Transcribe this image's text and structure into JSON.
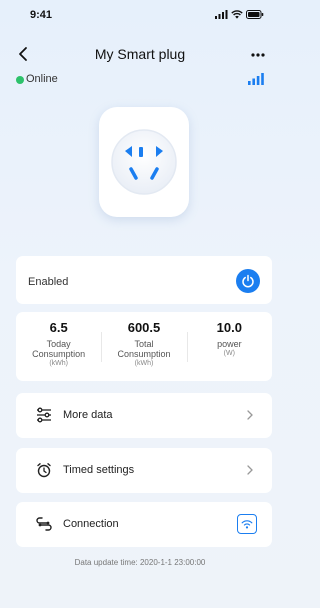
{
  "status_bar": {
    "time": "9:41"
  },
  "header": {
    "title": "My Smart plug"
  },
  "device": {
    "status": "Online",
    "status_color": "#2dc26b",
    "signal_color": "#1b7ef0"
  },
  "switch": {
    "label": "Enabled",
    "state": "on",
    "button_color": "#1b7ef0"
  },
  "stats": [
    {
      "value": "6.5",
      "label1": "Today",
      "label2": "Consumption",
      "unit": "(kWh)"
    },
    {
      "value": "600.5",
      "label1": "Total",
      "label2": "Consumption",
      "unit": "(kWh)"
    },
    {
      "value": "10.0",
      "label1": "power",
      "label2": "",
      "unit": "(W)"
    }
  ],
  "menu": {
    "more_data": {
      "label": "More data",
      "icon": "sliders-icon"
    },
    "timed_settings": {
      "label": "Timed settings",
      "icon": "alarm-clock-icon"
    },
    "connection": {
      "label": "Connection",
      "icon": "link-icon"
    }
  },
  "footer": {
    "update_time": "Data update time: 2020-1-1 23:00:00"
  }
}
